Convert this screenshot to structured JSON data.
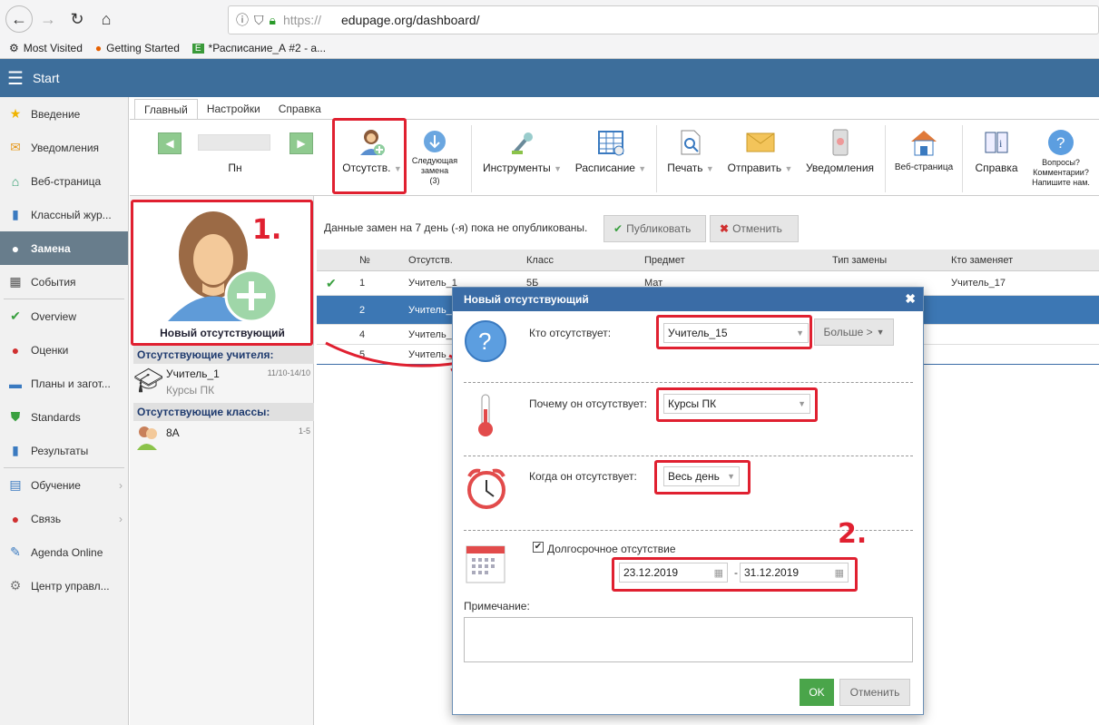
{
  "browser": {
    "url_prefix": "https://",
    "url_host": "edupage.org/dashboard/",
    "bookmarks": [
      "Most Visited",
      "Getting Started",
      "*Расписание_А #2 - а..."
    ]
  },
  "app": {
    "title": "Start"
  },
  "sidebar": {
    "items": [
      {
        "label": "Введение",
        "icon": "star-icon"
      },
      {
        "label": "Уведомления",
        "icon": "envelope-icon"
      },
      {
        "label": "Веб-страница",
        "icon": "house-icon"
      },
      {
        "label": "Классный жур...",
        "icon": "book-icon"
      },
      {
        "label": "Замена",
        "icon": "person-icon"
      },
      {
        "label": "События",
        "icon": "calendar-icon"
      },
      {
        "label": "Overview",
        "icon": "check-circle-icon"
      },
      {
        "label": "Оценки",
        "icon": "grade-icon"
      },
      {
        "label": "Планы и загот...",
        "icon": "briefcase-icon"
      },
      {
        "label": "Standards",
        "icon": "shield-icon"
      },
      {
        "label": "Результаты",
        "icon": "bar-chart-icon"
      },
      {
        "label": "Обучение",
        "icon": "book-open-icon"
      },
      {
        "label": "Связь",
        "icon": "chat-icon"
      },
      {
        "label": "Agenda Online",
        "icon": "pen-icon"
      },
      {
        "label": "Центр управл...",
        "icon": "gear-icon"
      }
    ]
  },
  "tabs": [
    "Главный",
    "Настройки",
    "Справка"
  ],
  "ribbon": {
    "day": "Пн",
    "absent": "Отсутств.",
    "next_sub_1": "Следующая",
    "next_sub_2": "замена",
    "next_sub_3": "(3)",
    "tools": "Инструменты",
    "schedule": "Расписание",
    "print": "Печать",
    "send": "Отправить",
    "notify": "Уведомления",
    "website": "Веб-страница",
    "help": "Справка",
    "q1": "Вопросы?",
    "q2": "Комментарии?",
    "q3": "Напишите нам."
  },
  "left": {
    "new_absent": "Новый отсутствующий",
    "teachers_header": "Отсутствующие учителя:",
    "teacher_name": "Учитель_1",
    "teacher_dates": "11/10-14/10",
    "teacher_reason": "Курсы ПК",
    "classes_header": "Отсутствующие классы:",
    "class_name": "8A",
    "class_periods": "1-5"
  },
  "main": {
    "notice": "Данные замен на 7 день (-я) пока не опубликованы.",
    "publish": "Публиковать",
    "cancel": "Отменить",
    "columns": [
      "№",
      "Отсутств.",
      "Класс",
      "Предмет",
      "Тип замены",
      "Кто заменяет"
    ],
    "rows": [
      {
        "n": "1",
        "absent": "Учитель_1",
        "cls": "5Б",
        "subj": "Мат",
        "who": "Учитель_17"
      },
      {
        "n": "2",
        "absent": "Учитель_",
        "cls": "",
        "subj": "",
        "who": ""
      },
      {
        "n": "4",
        "absent": "Учитель_",
        "cls": "",
        "subj": "",
        "who": ""
      },
      {
        "n": "5",
        "absent": "Учитель_",
        "cls": "",
        "subj": "",
        "who": ""
      }
    ]
  },
  "dialog": {
    "title": "Новый отсутствующий",
    "who_label": "Кто отсутствует:",
    "who_value": "Учитель_15",
    "more": "Больше >",
    "why_label": "Почему он отсутствует:",
    "why_value": "Курсы ПК",
    "when_label": "Когда он отсутствует:",
    "when_value": "Весь день",
    "longterm": "Долгосрочное отсутствие",
    "date_from": "23.12.2019",
    "date_sep": "-",
    "date_to": "31.12.2019",
    "note_label": "Примечание:",
    "ok": "OK",
    "cancel": "Отменить"
  },
  "annotations": {
    "one": "1.",
    "two": "2."
  },
  "colors": {
    "header": "#3d6e9b",
    "accent_red": "#e02030",
    "ok_green": "#4aa54a",
    "selected_row": "#3c77b4"
  }
}
